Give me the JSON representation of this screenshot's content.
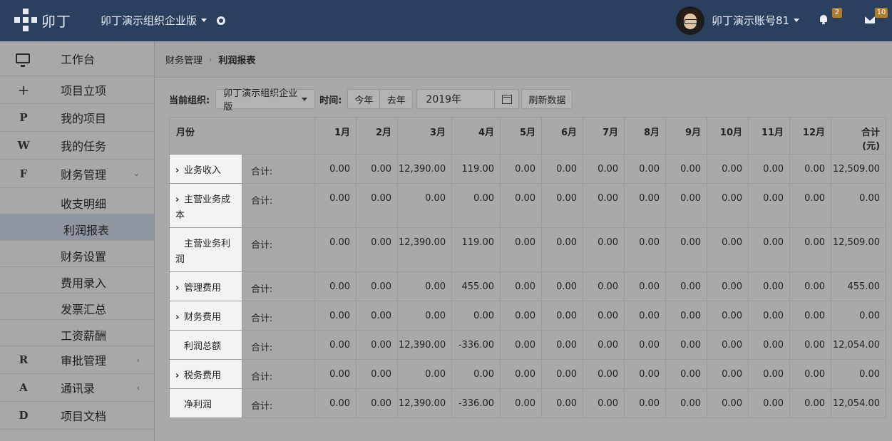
{
  "header": {
    "logo_text": "卯丁",
    "org": "卯丁演示组织企业版",
    "account": "卯丁演示账号81",
    "bell_count": "2",
    "mail_count": "10"
  },
  "sidebar": {
    "workbench": "工作台",
    "items": [
      {
        "icon": "+",
        "label": "项目立项"
      },
      {
        "icon": "P",
        "label": "我的项目"
      },
      {
        "icon": "W",
        "label": "我的任务"
      },
      {
        "icon": "F",
        "label": "财务管理",
        "arrow": "⌄"
      }
    ],
    "sub_items": [
      "收支明细",
      "利润报表",
      "财务设置",
      "费用录入",
      "发票汇总",
      "工资薪酬"
    ],
    "lower_items": [
      {
        "icon": "R",
        "label": "审批管理",
        "arrow": "‹"
      },
      {
        "icon": "A",
        "label": "通讯录",
        "arrow": "‹"
      },
      {
        "icon": "D",
        "label": "项目文档"
      }
    ]
  },
  "breadcrumb": {
    "parent": "财务管理",
    "sep": "›",
    "current": "利润报表"
  },
  "filters": {
    "org_label": "当前组织:",
    "org_value": "卯丁演示组织企业版",
    "time_label": "时间:",
    "this_year": "今年",
    "last_year": "去年",
    "year_value": "2019年",
    "refresh": "刷新数据"
  },
  "table": {
    "col_month": "月份",
    "months": [
      "1月",
      "2月",
      "3月",
      "4月",
      "5月",
      "6月",
      "7月",
      "8月",
      "9月",
      "10月",
      "11月",
      "12月"
    ],
    "total_header_1": "合计",
    "total_header_2": "(元)",
    "sum_label": "合计:",
    "rows": [
      {
        "name": "业务收入",
        "expand": true,
        "values": [
          "0.00",
          "0.00",
          "12,390.00",
          "119.00",
          "0.00",
          "0.00",
          "0.00",
          "0.00",
          "0.00",
          "0.00",
          "0.00",
          "0.00"
        ],
        "total": "12,509.00"
      },
      {
        "name": "主营业务成本",
        "expand": true,
        "values": [
          "0.00",
          "0.00",
          "0.00",
          "0.00",
          "0.00",
          "0.00",
          "0.00",
          "0.00",
          "0.00",
          "0.00",
          "0.00",
          "0.00"
        ],
        "total": "0.00"
      },
      {
        "name": "主营业务利润",
        "expand": false,
        "values": [
          "0.00",
          "0.00",
          "12,390.00",
          "119.00",
          "0.00",
          "0.00",
          "0.00",
          "0.00",
          "0.00",
          "0.00",
          "0.00",
          "0.00"
        ],
        "total": "12,509.00"
      },
      {
        "name": "管理费用",
        "expand": true,
        "values": [
          "0.00",
          "0.00",
          "0.00",
          "455.00",
          "0.00",
          "0.00",
          "0.00",
          "0.00",
          "0.00",
          "0.00",
          "0.00",
          "0.00"
        ],
        "total": "455.00"
      },
      {
        "name": "财务费用",
        "expand": true,
        "values": [
          "0.00",
          "0.00",
          "0.00",
          "0.00",
          "0.00",
          "0.00",
          "0.00",
          "0.00",
          "0.00",
          "0.00",
          "0.00",
          "0.00"
        ],
        "total": "0.00"
      },
      {
        "name": "利润总额",
        "expand": false,
        "values": [
          "0.00",
          "0.00",
          "12,390.00",
          "-336.00",
          "0.00",
          "0.00",
          "0.00",
          "0.00",
          "0.00",
          "0.00",
          "0.00",
          "0.00"
        ],
        "total": "12,054.00"
      },
      {
        "name": "税务费用",
        "expand": true,
        "values": [
          "0.00",
          "0.00",
          "0.00",
          "0.00",
          "0.00",
          "0.00",
          "0.00",
          "0.00",
          "0.00",
          "0.00",
          "0.00",
          "0.00"
        ],
        "total": "0.00"
      },
      {
        "name": "净利润",
        "expand": false,
        "values": [
          "0.00",
          "0.00",
          "12,390.00",
          "-336.00",
          "0.00",
          "0.00",
          "0.00",
          "0.00",
          "0.00",
          "0.00",
          "0.00",
          "0.00"
        ],
        "total": "12,054.00"
      }
    ]
  }
}
